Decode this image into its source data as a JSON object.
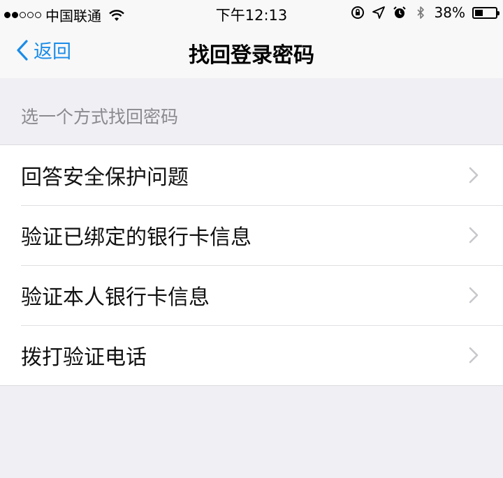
{
  "status_bar": {
    "carrier": "中国联通",
    "time": "下午12:13",
    "battery_percent": "38%",
    "battery_level": 0.38,
    "signal_bars_filled": 2,
    "signal_bars_total": 5,
    "icons": [
      "wifi-icon",
      "orientation-lock-icon",
      "location-icon",
      "alarm-icon",
      "bluetooth-icon",
      "battery-icon"
    ]
  },
  "nav": {
    "back_label": "返回",
    "title": "找回登录密码"
  },
  "section": {
    "header": "选一个方式找回密码",
    "items": [
      {
        "label": "回答安全保护问题"
      },
      {
        "label": "验证已绑定的银行卡信息"
      },
      {
        "label": "验证本人银行卡信息"
      },
      {
        "label": "拨打验证电话"
      }
    ]
  },
  "colors": {
    "accent": "#1a8ce8",
    "background": "#efeff4",
    "section_header": "#8a8a8f",
    "chevron": "#c7c7cc"
  }
}
